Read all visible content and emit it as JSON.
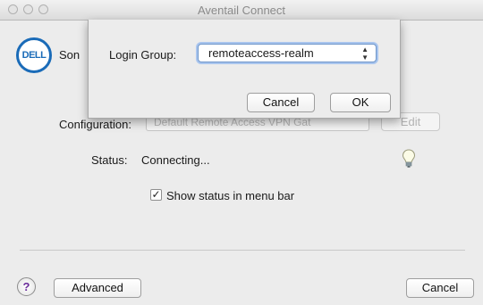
{
  "window": {
    "title": "Aventail Connect"
  },
  "logo": {
    "text": "DELL",
    "side_text": "Son"
  },
  "config": {
    "label": "Configuration:",
    "field_text": "Default Remote Access VPN Gat",
    "edit_label": "Edit"
  },
  "status": {
    "label": "Status:",
    "value": "Connecting..."
  },
  "checkbox": {
    "label": "Show status in menu bar",
    "checked": true
  },
  "footer": {
    "help_label": "?",
    "advanced_label": "Advanced",
    "cancel_label": "Cancel"
  },
  "sheet": {
    "login_group_label": "Login Group:",
    "login_group_value": "remoteaccess-realm",
    "cancel_label": "Cancel",
    "ok_label": "OK"
  },
  "colors": {
    "dell_blue": "#1a6bb8",
    "focus_ring": "#a9c5ee"
  }
}
